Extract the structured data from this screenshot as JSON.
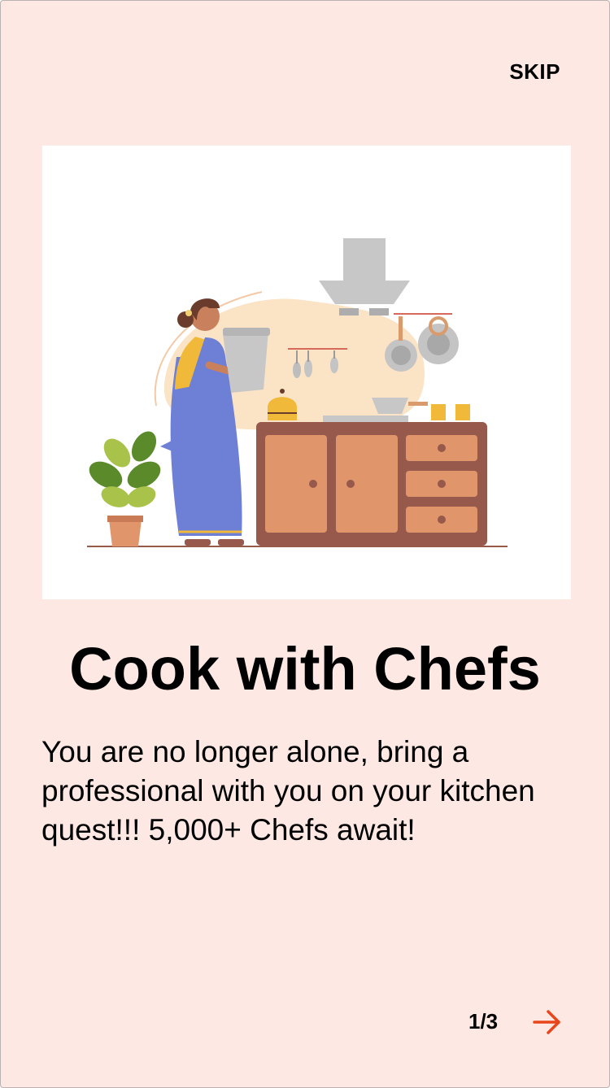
{
  "header": {
    "skip_label": "SKIP"
  },
  "illustration": {
    "icon": "woman-cooking-in-kitchen-illustration"
  },
  "content": {
    "title": "Cook with Chefs",
    "description": "You are no longer alone, bring a professional with you on your kitchen quest!!! 5,000+ Chefs await!"
  },
  "footer": {
    "page_indicator": "1/3",
    "next_icon": "arrow-right-icon"
  },
  "colors": {
    "background": "#fde8e3",
    "accent": "#e8461a"
  }
}
